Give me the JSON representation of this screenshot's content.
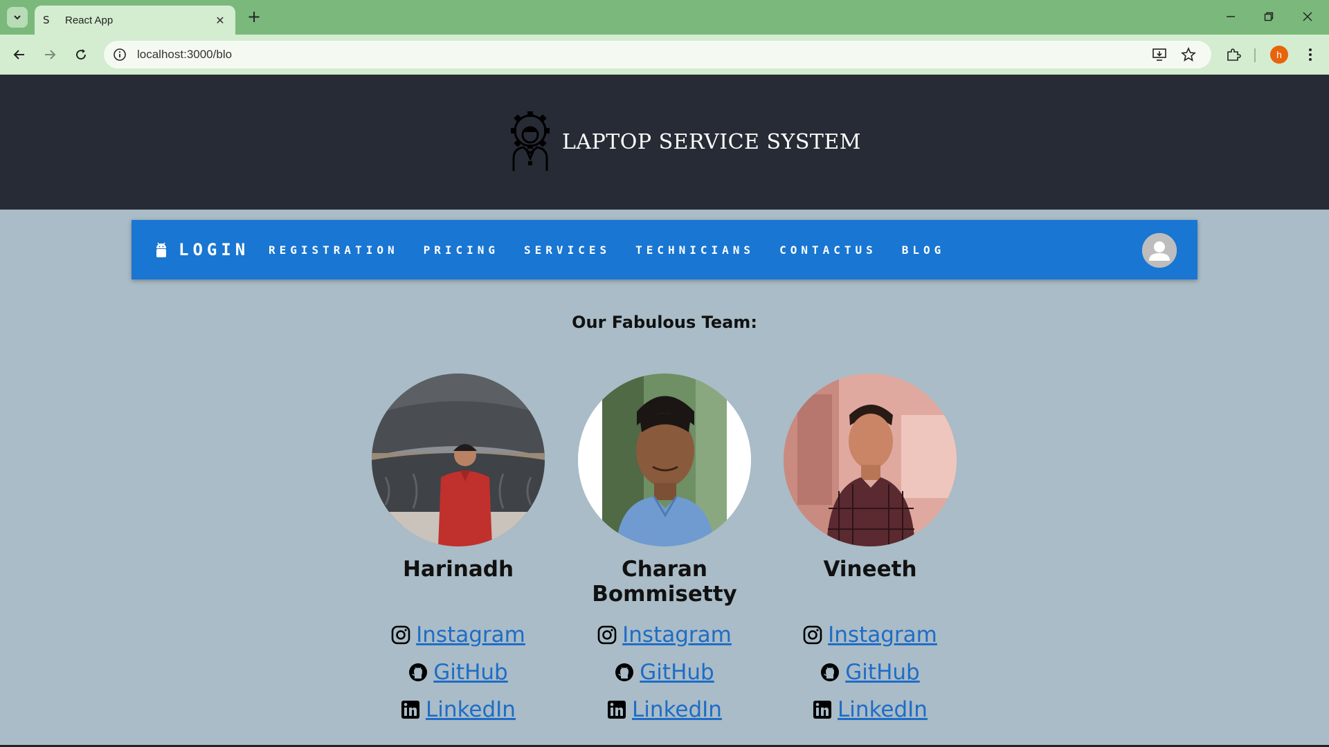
{
  "browser": {
    "tab_favicon": "S",
    "tab_title": "React App",
    "tab_close": "✕",
    "new_tab": "+",
    "url": "localhost:3000/blo",
    "profile_initial": "h",
    "profile_color": "#e8630a"
  },
  "header": {
    "title": "LAPTOP SERVICE SYSTEM",
    "logo_icon": "technician-gear-icon"
  },
  "navbar": {
    "login_label": "LOGIN",
    "links": [
      "REGISTRATION",
      "PRICING",
      "SERVICES",
      "TECHNICIANS",
      "CONTACTUS",
      "BLOG"
    ],
    "accent_color": "#1976d2"
  },
  "team": {
    "heading": "Our Fabulous Team:",
    "members": [
      {
        "name": "Harinadh",
        "links": {
          "instagram": "Instagram",
          "github": "GitHub",
          "linkedin": "LinkedIn"
        }
      },
      {
        "name": "Charan Bommisetty",
        "links": {
          "instagram": "Instagram",
          "github": "GitHub",
          "linkedin": "LinkedIn"
        }
      },
      {
        "name": "Vineeth",
        "links": {
          "instagram": "Instagram",
          "github": "GitHub",
          "linkedin": "LinkedIn"
        }
      }
    ]
  }
}
